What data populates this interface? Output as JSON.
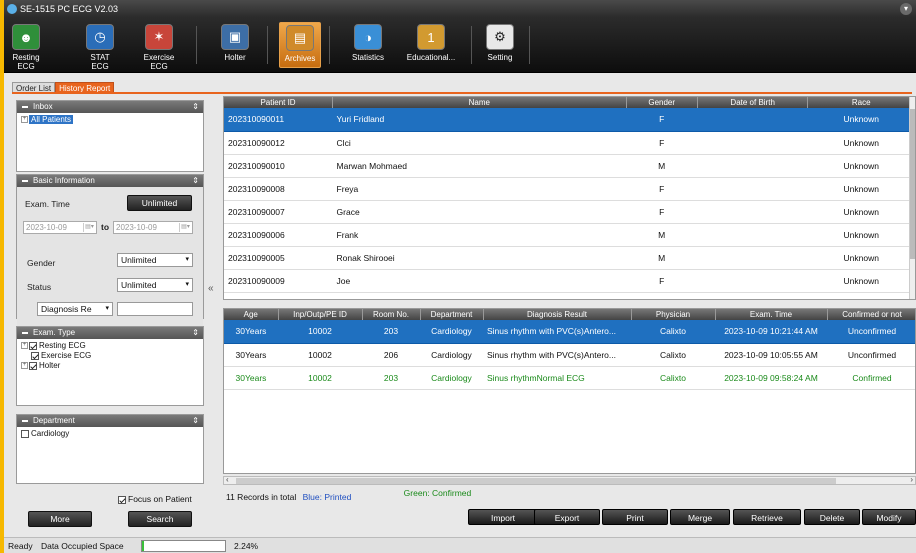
{
  "window": {
    "title": "SE-1515 PC ECG V2.03"
  },
  "toolbar": {
    "items": [
      {
        "label": "Resting ECG",
        "icon": "person-icon"
      },
      {
        "label": "STAT ECG",
        "icon": "clock-icon"
      },
      {
        "label": "Exercise ECG",
        "icon": "runner-icon"
      },
      {
        "label": "Holter",
        "icon": "holter-device-icon"
      },
      {
        "label": "Archives",
        "icon": "archive-icon"
      },
      {
        "label": "Statistics",
        "icon": "statistics-icon"
      },
      {
        "label": "Educational...",
        "icon": "education-icon"
      },
      {
        "label": "Setting",
        "icon": "gear-icon"
      }
    ],
    "active": "Archives"
  },
  "tabs": [
    "Order List",
    "History Report"
  ],
  "inbox": {
    "title": "Inbox",
    "items": [
      "All Patients"
    ]
  },
  "basic": {
    "title": "Basic Information",
    "exam_time_label": "Exam. Time",
    "unlimited_button": "Unlimited",
    "date_from": "2023-10-09",
    "to_label": "to",
    "date_to": "2023-10-09",
    "gender_label": "Gender",
    "gender_value": "Unlimited",
    "status_label": "Status",
    "status_value": "Unlimited",
    "diagnosis_combo": "Diagnosis Re",
    "diagnosis_text": ""
  },
  "exam_type": {
    "title": "Exam. Type",
    "items": [
      "Resting ECG",
      "Exercise ECG",
      "Holter"
    ]
  },
  "department": {
    "title": "Department",
    "items": [
      "Cardiology"
    ]
  },
  "focus_label": "Focus on Patient",
  "more_button": "More",
  "search_button": "Search",
  "patients": {
    "headers": [
      "Patient ID",
      "Name",
      "Gender",
      "Date of Birth",
      "Race"
    ],
    "rows": [
      [
        "202310090011",
        "Yuri Fridland",
        "F",
        "",
        "Unknown"
      ],
      [
        "202310090012",
        "Clci",
        "F",
        "",
        "Unknown"
      ],
      [
        "202310090010",
        "Marwan Mohmaed",
        "M",
        "",
        "Unknown"
      ],
      [
        "202310090008",
        "Freya",
        "F",
        "",
        "Unknown"
      ],
      [
        "202310090007",
        "Grace",
        "F",
        "",
        "Unknown"
      ],
      [
        "202310090006",
        "Frank",
        "M",
        "",
        "Unknown"
      ],
      [
        "202310090005",
        "Ronak Shirooei",
        "M",
        "",
        "Unknown"
      ],
      [
        "202310090009",
        "Joe",
        "F",
        "",
        "Unknown"
      ]
    ]
  },
  "exams": {
    "headers": [
      "Age",
      "Inp/Outp/PE ID",
      "Room No.",
      "Department",
      "Diagnosis Result",
      "Physician",
      "Exam. Time",
      "Confirmed or not"
    ],
    "rows": [
      [
        "30Years",
        "10002",
        "203",
        "Cardiology",
        "Sinus rhythm with PVC(s)Antero...",
        "Calixto",
        "2023-10-09 10:21:44 AM",
        "Unconfirmed"
      ],
      [
        "30Years",
        "10002",
        "206",
        "Cardiology",
        "Sinus rhythm with PVC(s)Antero...",
        "Calixto",
        "2023-10-09 10:05:55 AM",
        "Unconfirmed"
      ],
      [
        "30Years",
        "10002",
        "203",
        "Cardiology",
        "Sinus rhythmNormal ECG",
        "Calixto",
        "2023-10-09 09:58:24 AM",
        "Confirmed"
      ]
    ]
  },
  "records_text": "11 Records in total",
  "blue_text": "Blue: Printed",
  "green_text": "Green: Confirmed",
  "actions": [
    "Import",
    "Export",
    "Print",
    "Merge",
    "Retrieve",
    "Delete",
    "Modify"
  ],
  "status": {
    "ready": "Ready",
    "space_label": "Data Occupied Space",
    "percent": "2.24%",
    "fill_fraction": 0.0224
  },
  "colors": {
    "accent": "#e8641e",
    "selection": "#1f70c0",
    "confirmed": "#1a8a1a",
    "printed": "#1f4fc0"
  }
}
